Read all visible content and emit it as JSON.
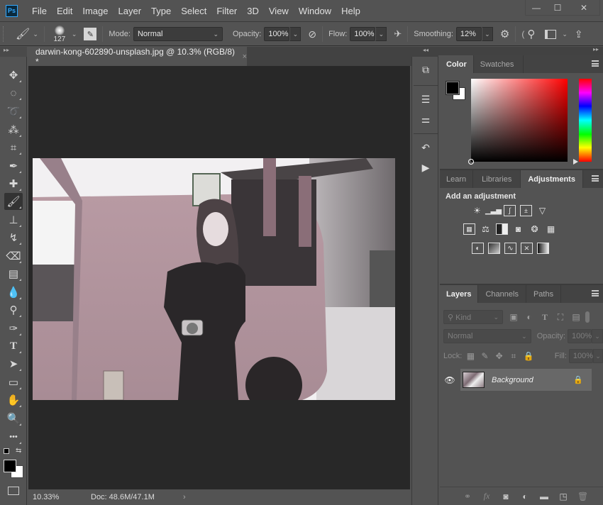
{
  "app": {
    "logo": "Ps",
    "menu": [
      "File",
      "Edit",
      "Image",
      "Layer",
      "Type",
      "Select",
      "Filter",
      "3D",
      "View",
      "Window",
      "Help"
    ],
    "window_controls": {
      "minimize": "—",
      "maximize": "☐",
      "close": "✕"
    }
  },
  "options_bar": {
    "brush_size": "127",
    "mode_label": "Mode:",
    "mode_value": "Normal",
    "opacity_label": "Opacity:",
    "opacity_value": "100%",
    "flow_label": "Flow:",
    "flow_value": "100%",
    "smoothing_label": "Smoothing:",
    "smoothing_value": "12%"
  },
  "document": {
    "tab_title": "darwin-kong-602890-unsplash.jpg @ 10.3% (RGB/8) *",
    "close_glyph": "×",
    "zoom": "10.33%",
    "doc_info": "Doc: 48.6M/47.1M",
    "status_arrow": "›"
  },
  "toolbox": {
    "tools": [
      {
        "name": "move-tool",
        "glyph": "✥"
      },
      {
        "name": "marquee-tool",
        "glyph": "◌"
      },
      {
        "name": "lasso-tool",
        "glyph": "➰"
      },
      {
        "name": "quick-selection-tool",
        "glyph": "⁂"
      },
      {
        "name": "crop-tool",
        "glyph": "⌗"
      },
      {
        "name": "eyedropper-tool",
        "glyph": "✒"
      },
      {
        "name": "healing-brush-tool",
        "glyph": "✚"
      },
      {
        "name": "brush-tool",
        "glyph": "🖌"
      },
      {
        "name": "clone-stamp-tool",
        "glyph": "⊥"
      },
      {
        "name": "history-brush-tool",
        "glyph": "↯"
      },
      {
        "name": "eraser-tool",
        "glyph": "⌫"
      },
      {
        "name": "gradient-tool",
        "glyph": "▤"
      },
      {
        "name": "blur-tool",
        "glyph": "💧"
      },
      {
        "name": "dodge-tool",
        "glyph": "⚲"
      },
      {
        "name": "pen-tool",
        "glyph": "✑"
      },
      {
        "name": "type-tool",
        "glyph": "T"
      },
      {
        "name": "path-selection-tool",
        "glyph": "➤"
      },
      {
        "name": "rectangle-tool",
        "glyph": "▭"
      },
      {
        "name": "hand-tool",
        "glyph": "✋"
      },
      {
        "name": "zoom-tool",
        "glyph": "🔍"
      },
      {
        "name": "edit-toolbar",
        "glyph": "•••"
      }
    ]
  },
  "color_panel": {
    "tabs": [
      "Color",
      "Swatches"
    ],
    "foreground": "#000000",
    "background": "#ffffff",
    "hue": "#ff0000"
  },
  "adjustments_panel": {
    "tabs": [
      "Learn",
      "Libraries",
      "Adjustments"
    ],
    "title": "Add an adjustment",
    "rows": [
      [
        "brightness-contrast",
        "levels",
        "curves",
        "exposure",
        "vibrance"
      ],
      [
        "hue-saturation",
        "color-balance",
        "black-white",
        "photo-filter",
        "channel-mixer",
        "color-lookup"
      ],
      [
        "invert",
        "posterize",
        "threshold",
        "selective-color",
        "gradient-map"
      ]
    ]
  },
  "layers_panel": {
    "tabs": [
      "Layers",
      "Channels",
      "Paths"
    ],
    "filter_label": "Kind",
    "blend_mode": "Normal",
    "opacity_label": "Opacity:",
    "opacity_value": "100%",
    "lock_label": "Lock:",
    "fill_label": "Fill:",
    "fill_value": "100%",
    "layers": [
      {
        "name": "Background",
        "visible": true,
        "locked": true
      }
    ]
  }
}
